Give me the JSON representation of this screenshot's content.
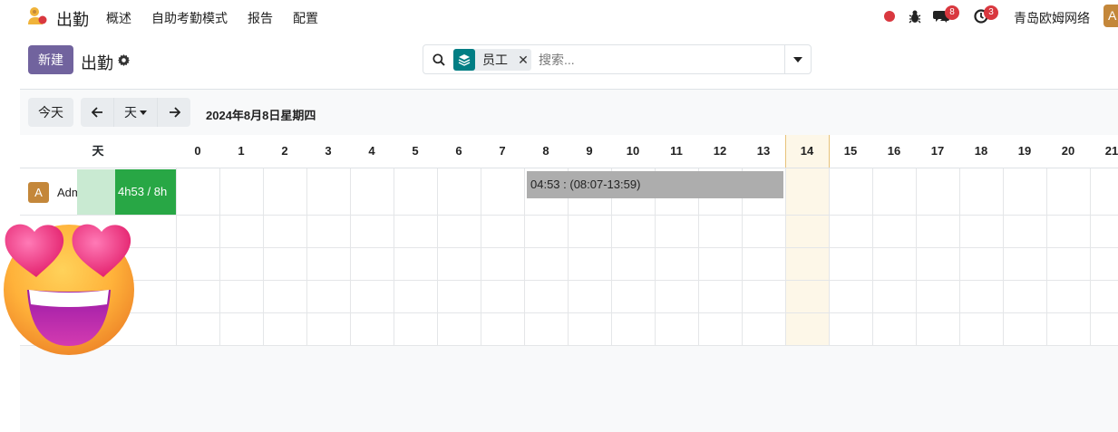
{
  "navbar": {
    "app_name": "出勤",
    "menu": [
      "概述",
      "自助考勤模式",
      "报告",
      "配置"
    ],
    "chat_count": "8",
    "activity_count": "3",
    "company": "青岛欧姆网络",
    "user_initial": "A"
  },
  "control_panel": {
    "new_label": "新建",
    "title": "出勤",
    "facet_label": "员工",
    "search_placeholder": "搜索..."
  },
  "gantt": {
    "today_label": "今天",
    "scale_label": "天",
    "date_label": "2024年8月8日星期四",
    "day_header": "天",
    "hours": [
      "0",
      "1",
      "2",
      "3",
      "4",
      "5",
      "6",
      "7",
      "8",
      "9",
      "10",
      "11",
      "12",
      "13",
      "14",
      "15",
      "16",
      "17",
      "18",
      "19",
      "20",
      "21"
    ],
    "current_hour": "14",
    "rows": [
      {
        "avatar": "A",
        "name": "Administrator",
        "progress_text": "4h53 / 8h",
        "progress_worked_hours": 4.88,
        "progress_planned_hours": 8
      }
    ],
    "pills": [
      {
        "label": "04:53 : (08:07-13:59)",
        "start": "08:07",
        "end": "13:59"
      }
    ]
  },
  "colors": {
    "brand": "#71639e",
    "accent_teal": "#017e84",
    "badge_red": "#d9383f",
    "progress_green": "#28a745",
    "today_highlight": "#fdf7e8"
  }
}
